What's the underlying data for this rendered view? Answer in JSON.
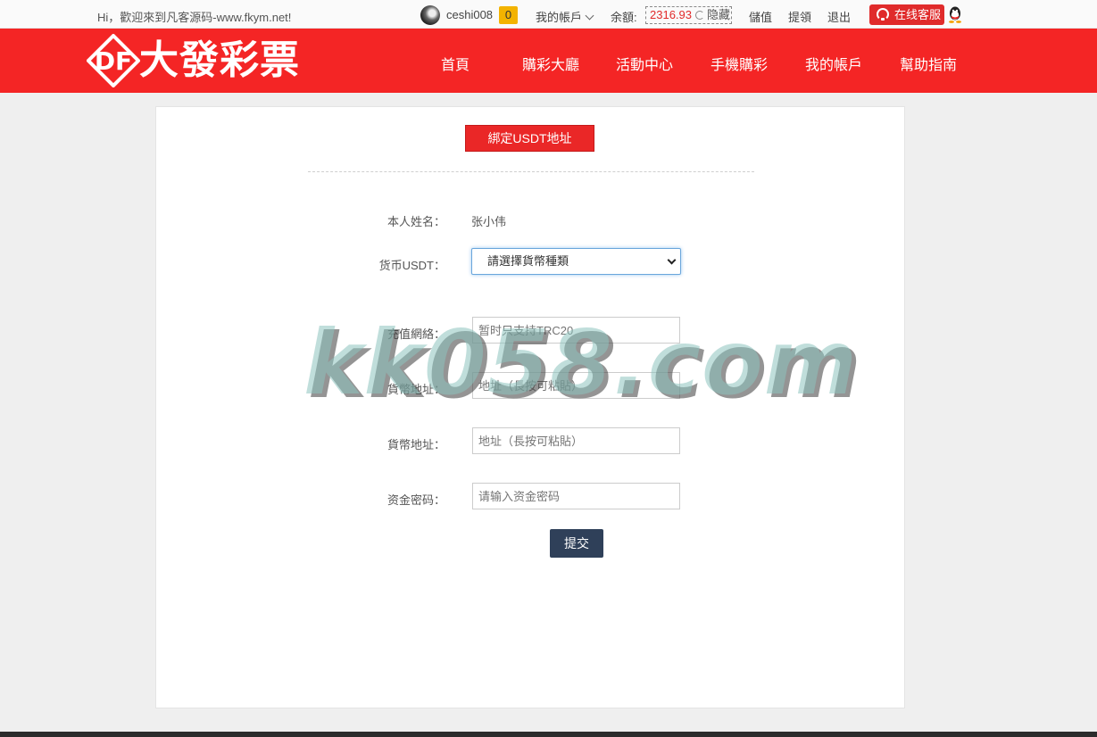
{
  "topbar": {
    "welcome": "Hi，歡迎來到凡客源码-www.fkym.net!",
    "username": "ceshi008",
    "message_count": "0",
    "my_account": "我的帳戶",
    "balance_label": "余額:",
    "balance_value": "2316.93",
    "hide_label": "隐藏",
    "deposit": "儲值",
    "withdraw": "提領",
    "logout": "退出",
    "support": "在线客服"
  },
  "header": {
    "logo_mark": "DF",
    "logo_text": "大發彩票",
    "nav": [
      "首頁",
      "購彩大廳",
      "活動中心",
      "手機購彩",
      "我的帳戶",
      "幫助指南"
    ]
  },
  "form": {
    "title": "綁定USDT地址",
    "name_label": "本人姓名：",
    "name_value": "张小伟",
    "currency_label": "货币USDT：",
    "currency_selected": "請選擇貨幣種類",
    "network_label": "充值網絡：",
    "network_placeholder": "暂时只支持TRC20",
    "address_label_1": "貨幣地址：",
    "address_placeholder_1": "地址（長按可粘貼）",
    "address_label_2": "貨幣地址：",
    "address_placeholder_2": "地址（長按可粘貼）",
    "password_label": "资金密码：",
    "password_placeholder": "请输入资金密码",
    "submit": "提交"
  },
  "watermark": "kk058.com",
  "colors": {
    "brand_red": "#f42525",
    "button_red": "#ea2727",
    "submit_navy": "#2f4059",
    "badge_yellow": "#f3b300"
  }
}
